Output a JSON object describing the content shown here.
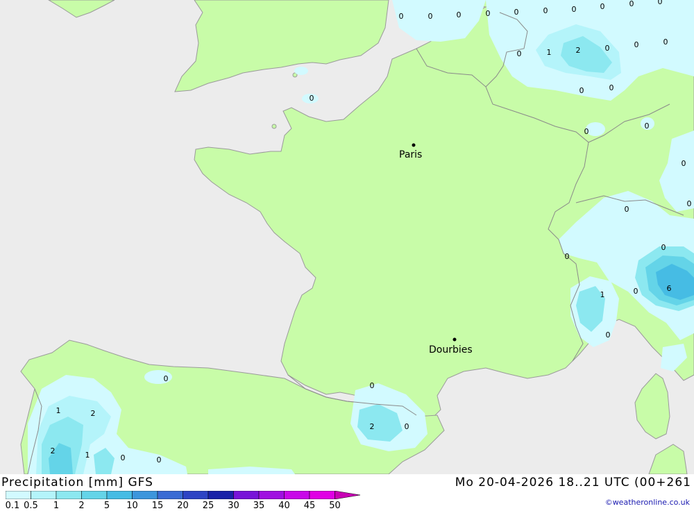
{
  "map": {
    "colors": {
      "sea": "#ececec",
      "land": "#c8fca8",
      "border": "#8a8a8a",
      "coast": "#9a9a9a"
    },
    "cities": [
      {
        "name": "Paris"
      },
      {
        "name": "Dourbies"
      }
    ],
    "contour_labels": [
      "0",
      "0",
      "0",
      "0",
      "0",
      "0",
      "0",
      "0",
      "0",
      "0",
      "1",
      "2",
      "0",
      "0",
      "0",
      "0",
      "0",
      "0",
      "0",
      "0",
      "0",
      "0",
      "0",
      "0",
      "0",
      "1",
      "0",
      "6",
      "0",
      "0",
      "2",
      "1",
      "2",
      "1",
      "0",
      "0",
      "2",
      "0"
    ]
  },
  "footer": {
    "title": "Precipitation [mm] GFS",
    "datetime": "Mo 20-04-2026 18..21 UTC (00+261",
    "credit": "©weatheronline.co.uk"
  },
  "legend": {
    "ticks": [
      "0.1",
      "0.5",
      "1",
      "2",
      "5",
      "10",
      "15",
      "20",
      "25",
      "30",
      "35",
      "40",
      "45",
      "50"
    ],
    "colors": [
      "#d2faff",
      "#b4f4fa",
      "#8ce8f0",
      "#64d4e8",
      "#46bce4",
      "#3c96dc",
      "#3a6cd4",
      "#2e44c4",
      "#1a22a8",
      "#7814d8",
      "#a010e0",
      "#c808e8",
      "#e000e4",
      "#c800b4"
    ]
  }
}
